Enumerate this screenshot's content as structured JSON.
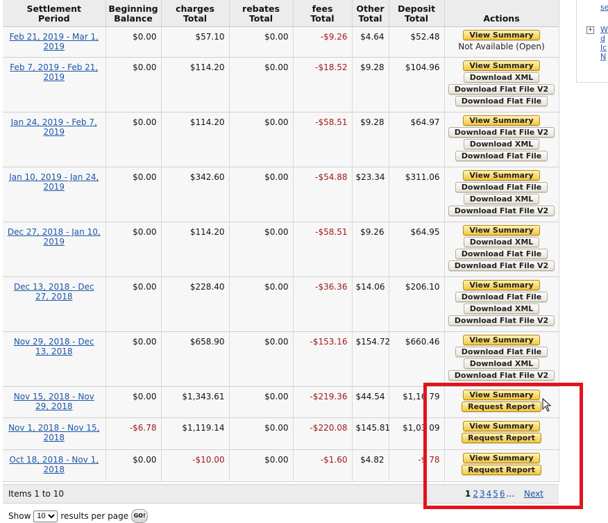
{
  "columns": [
    {
      "l1": "Settlement",
      "l2": "Period"
    },
    {
      "l1": "Beginning",
      "l2": "Balance"
    },
    {
      "l1": "charges",
      "l2": "Total"
    },
    {
      "l1": "rebates",
      "l2": "Total"
    },
    {
      "l1": "fees",
      "l2": "Total"
    },
    {
      "l1": "Other",
      "l2": "Total"
    },
    {
      "l1": "Deposit",
      "l2": "Total"
    },
    {
      "l1": "Actions",
      "l2": ""
    }
  ],
  "rows": [
    {
      "l1": "Feb 21, 2019 - Mar 1,",
      "l2": "2019",
      "begin": "$0.00",
      "charges": "$57.10",
      "rebates": "$0.00",
      "fees": "-$9.26",
      "other": "$4.64",
      "deposit": "$52.48",
      "buttons": [
        "View Summary"
      ],
      "status": "Not Available (Open)"
    },
    {
      "l1": "Feb 7, 2019 - Feb 21,",
      "l2": "2019",
      "begin": "$0.00",
      "charges": "$114.20",
      "rebates": "$0.00",
      "fees": "-$18.52",
      "other": "$9.28",
      "deposit": "$104.96",
      "buttons": [
        "View Summary",
        "Download XML",
        "Download Flat File V2",
        "Download Flat File"
      ]
    },
    {
      "l1": "Jan 24, 2019 - Feb 7,",
      "l2": "2019",
      "begin": "$0.00",
      "charges": "$114.20",
      "rebates": "$0.00",
      "fees": "-$58.51",
      "other": "$9.28",
      "deposit": "$64.97",
      "buttons": [
        "View Summary",
        "Download Flat File V2",
        "Download XML",
        "Download Flat File"
      ]
    },
    {
      "l1": "Jan 10, 2019 - Jan 24,",
      "l2": "2019",
      "begin": "$0.00",
      "charges": "$342.60",
      "rebates": "$0.00",
      "fees": "-$54.88",
      "other": "$23.34",
      "deposit": "$311.06",
      "buttons": [
        "View Summary",
        "Download Flat File",
        "Download XML",
        "Download Flat File V2"
      ]
    },
    {
      "l1": "Dec 27, 2018 - Jan 10,",
      "l2": "2019",
      "begin": "$0.00",
      "charges": "$114.20",
      "rebates": "$0.00",
      "fees": "-$58.51",
      "other": "$9.26",
      "deposit": "$64.95",
      "buttons": [
        "View Summary",
        "Download XML",
        "Download Flat File",
        "Download Flat File V2"
      ]
    },
    {
      "l1": "Dec 13, 2018 - Dec",
      "l2": "27, 2018",
      "begin": "$0.00",
      "charges": "$228.40",
      "rebates": "$0.00",
      "fees": "-$36.36",
      "other": "$14.06",
      "deposit": "$206.10",
      "buttons": [
        "View Summary",
        "Download Flat File",
        "Download XML",
        "Download Flat File V2"
      ]
    },
    {
      "l1": "Nov 29, 2018 - Dec",
      "l2": "13, 2018",
      "begin": "$0.00",
      "charges": "$658.90",
      "rebates": "$0.00",
      "fees": "-$153.16",
      "other": "$154.72",
      "deposit": "$660.46",
      "buttons": [
        "View Summary",
        "Download Flat File",
        "Download XML",
        "Download Flat File V2"
      ]
    },
    {
      "l1": "Nov 15, 2018 - Nov",
      "l2": "29, 2018",
      "begin": "$0.00",
      "charges": "$1,343.61",
      "rebates": "$0.00",
      "fees": "-$219.36",
      "other": "$44.54",
      "deposit": "$1,16 79",
      "buttons": [
        "View Summary",
        "Request Report"
      ]
    },
    {
      "l1": "Nov 1, 2018 - Nov 15,",
      "l2": "2018",
      "begin": "-$6.78",
      "charges": "$1,119.14",
      "rebates": "$0.00",
      "fees": "-$220.08",
      "other": "$145.81",
      "deposit": "$1,03 09",
      "buttons": [
        "View Summary",
        "Request Report"
      ]
    },
    {
      "l1": "Oct 18, 2018 - Nov 1,",
      "l2": "2018",
      "begin": "$0.00",
      "charges": "-$10.00",
      "rebates": "$0.00",
      "fees": "-$1.60",
      "other": "$4.82",
      "deposit": "-$ 78",
      "buttons": [
        "View Summary",
        "Request Report"
      ]
    }
  ],
  "footer": {
    "items_label": "Items 1 to 10",
    "pages": [
      "1",
      "2",
      "3",
      "4",
      "5",
      "6"
    ],
    "ellipsis": "...",
    "next": "Next"
  },
  "show": {
    "prefix": "Show",
    "value": "10",
    "suffix": "results per page",
    "go": "GO!"
  },
  "sidebar": {
    "top_link": "se",
    "line1": "W",
    "line2": "d",
    "line3": "Ic",
    "line4": "N"
  }
}
